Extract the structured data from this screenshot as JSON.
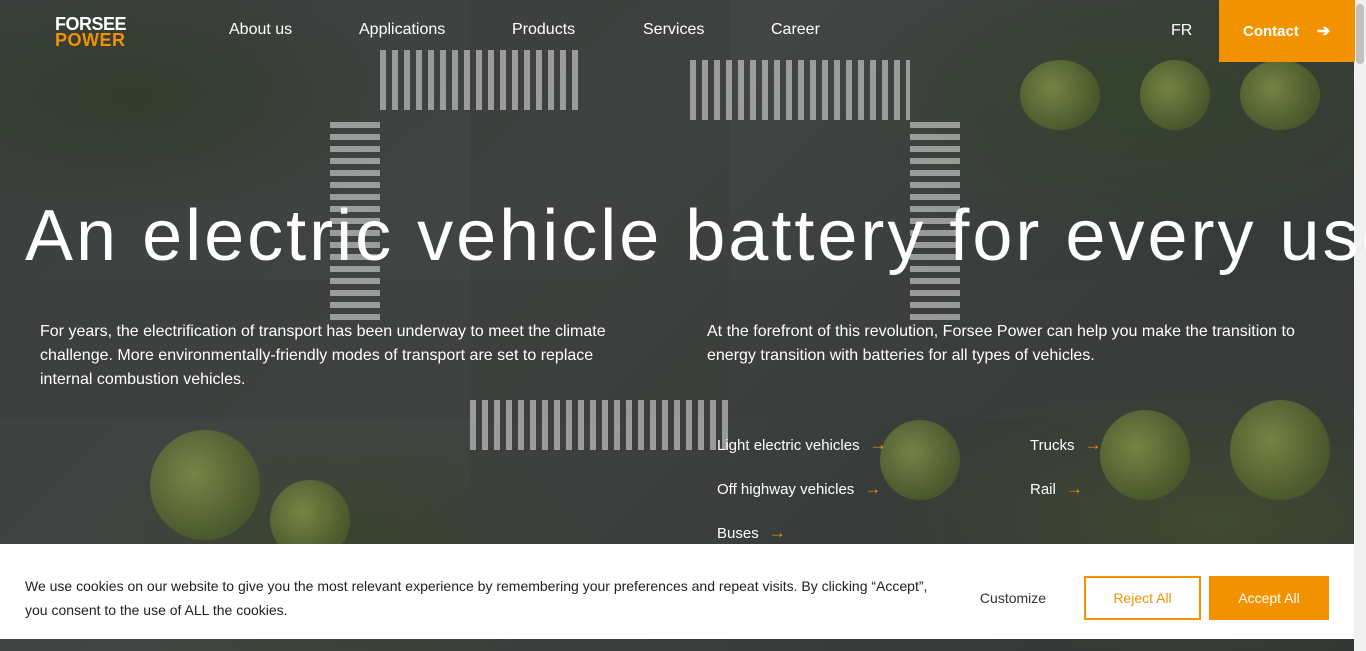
{
  "brand": {
    "line1": "FORSEE",
    "line2": "POWER",
    "accent": "#f39200"
  },
  "nav": {
    "items": [
      {
        "label": "About us"
      },
      {
        "label": "Applications"
      },
      {
        "label": "Products"
      },
      {
        "label": "Services"
      },
      {
        "label": "Career"
      }
    ],
    "lang": "FR",
    "contact": "Contact",
    "contact_icon": "arrow-right-icon"
  },
  "hero": {
    "headline": "An electric vehicle battery for every use",
    "left_text": "For years, the electrification of transport has been underway to meet the climate challenge. More environmentally-friendly modes of transport are set to replace internal combustion vehicles.",
    "right_text": "At the forefront of this revolution, Forsee Power can help you make the transition to energy transition with batteries for all types of vehicles.",
    "links": [
      {
        "label": "Light electric vehicles"
      },
      {
        "label": "Trucks"
      },
      {
        "label": "Off highway vehicles"
      },
      {
        "label": "Rail"
      },
      {
        "label": "Buses"
      }
    ]
  },
  "cookie": {
    "text": "We use cookies on our website to give you the most relevant experience by remembering your preferences and repeat visits. By clicking “Accept”, you consent to the use of ALL the cookies.",
    "customize": "Customize",
    "reject": "Reject All",
    "accept": "Accept All"
  }
}
